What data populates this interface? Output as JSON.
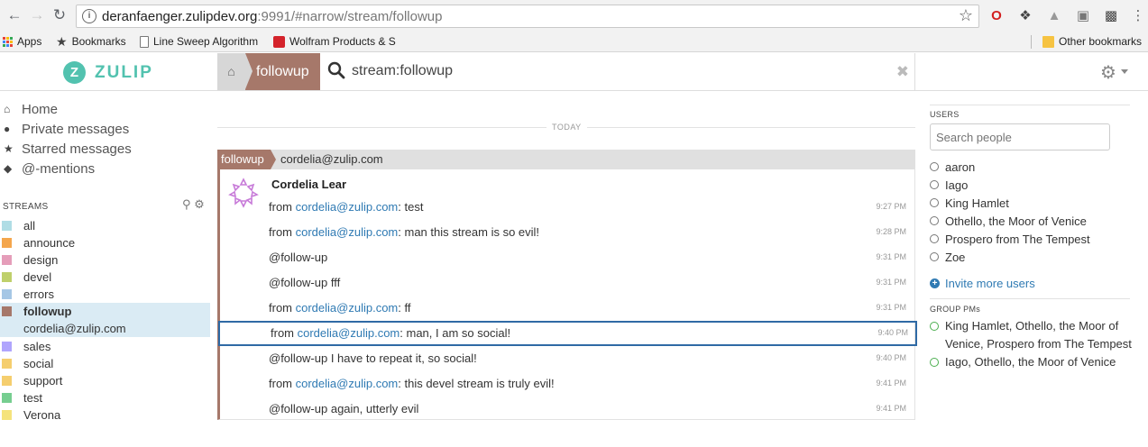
{
  "browser": {
    "url_host": "deranfaenger.zulipdev.org",
    "url_rest": ":9991/#narrow/stream/followup",
    "bookmarks": [
      {
        "label": "Apps"
      },
      {
        "label": "Bookmarks"
      },
      {
        "label": "Line Sweep Algorithm"
      },
      {
        "label": "Wolfram Products & S"
      }
    ],
    "other_bookmarks": "Other bookmarks"
  },
  "header": {
    "logo_letter": "Z",
    "logo_text": "ZULIP",
    "stream_tab": "followup",
    "search_query": "stream:followup"
  },
  "left_sidebar": {
    "nav": [
      {
        "label": "Home",
        "icon": "home-icon"
      },
      {
        "label": "Private messages",
        "icon": "user-icon"
      },
      {
        "label": "Starred messages",
        "icon": "star-icon"
      },
      {
        "label": "@-mentions",
        "icon": "tag-icon"
      }
    ],
    "streams_header": "STREAMS",
    "streams": [
      {
        "name": "all",
        "color": "#b0dde5"
      },
      {
        "name": "announce",
        "color": "#f4a64d"
      },
      {
        "name": "design",
        "color": "#e59db9"
      },
      {
        "name": "devel",
        "color": "#bfd06b"
      },
      {
        "name": "errors",
        "color": "#a6c7e5"
      },
      {
        "name": "followup",
        "color": "#a6786a"
      },
      {
        "name": "sales",
        "color": "#b0a5fd"
      },
      {
        "name": "social",
        "color": "#f5ce6e"
      },
      {
        "name": "support",
        "color": "#f5ce6e"
      },
      {
        "name": "test",
        "color": "#76ce90"
      },
      {
        "name": "Verona",
        "color": "#f5e37c"
      }
    ],
    "active_topic": "cordelia@zulip.com"
  },
  "messages": {
    "date_divider": "TODAY",
    "recipient_stream": "followup",
    "recipient_topic": "cordelia@zulip.com",
    "sender": "Cordelia Lear",
    "items": [
      {
        "prefix": "from ",
        "link": "cordelia@zulip.com",
        "text": ": test",
        "time": "9:27 PM"
      },
      {
        "prefix": "from ",
        "link": "cordelia@zulip.com",
        "text": ": man this stream is so evil!",
        "time": "9:28 PM"
      },
      {
        "prefix": "@follow-up",
        "link": "",
        "text": "",
        "time": "9:31 PM"
      },
      {
        "prefix": "@follow-up fff",
        "link": "",
        "text": "",
        "time": "9:31 PM"
      },
      {
        "prefix": "from ",
        "link": "cordelia@zulip.com",
        "text": ": ff",
        "time": "9:31 PM"
      },
      {
        "prefix": "from ",
        "link": "cordelia@zulip.com",
        "text": ": man, I am so social!",
        "time": "9:40 PM"
      },
      {
        "prefix": "@follow-up I have to repeat it, so social!",
        "link": "",
        "text": "",
        "time": "9:40 PM"
      },
      {
        "prefix": "from ",
        "link": "cordelia@zulip.com",
        "text": ": this devel stream is truly evil!",
        "time": "9:41 PM"
      },
      {
        "prefix": "@follow-up again, utterly evil",
        "link": "",
        "text": "",
        "time": "9:41 PM"
      }
    ]
  },
  "right_sidebar": {
    "users_header": "USERS",
    "search_placeholder": "Search people",
    "users": [
      {
        "name": "aaron"
      },
      {
        "name": "Iago"
      },
      {
        "name": "King Hamlet"
      },
      {
        "name": "Othello, the Moor of Venice"
      },
      {
        "name": "Prospero from The Tempest"
      },
      {
        "name": "Zoe"
      }
    ],
    "invite_label": "Invite more users",
    "group_header": "GROUP PMs",
    "groups": [
      {
        "line1": "King Hamlet, Othello, the Moor of",
        "line2": "Venice, Prospero from The Tempest"
      },
      {
        "line1": "Iago, Othello, the Moor of Venice",
        "line2": ""
      }
    ]
  }
}
